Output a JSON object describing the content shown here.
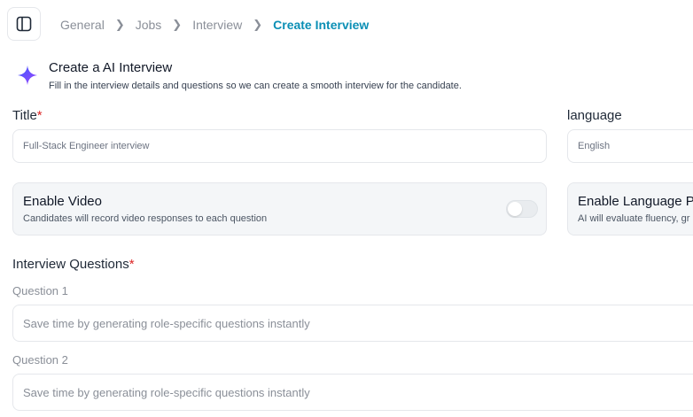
{
  "topbar": {
    "sidebar_toggle_icon": "sidebar-panel-icon",
    "breadcrumb": [
      {
        "label": "General"
      },
      {
        "label": "Jobs"
      },
      {
        "label": "Interview"
      },
      {
        "label": "Create Interview"
      }
    ],
    "separator_icon": "chevron-right-icon"
  },
  "header": {
    "icon": "sparkle-icon",
    "title": "Create a  AI Interview",
    "subtitle": "Fill in the interview details and questions so we can create a smooth interview for the candidate."
  },
  "form": {
    "title_label": "Title",
    "required_mark": "*",
    "title_value": "Full-Stack Engineer interview",
    "language_label": "language",
    "language_value": "English",
    "video_card": {
      "title": "Enable Video",
      "description": "Candidates will record video responses to each question",
      "enabled": false
    },
    "language_card": {
      "title": "Enable Language Pr",
      "description": "AI will evaluate fluency, gr"
    },
    "questions_label": "Interview Questions",
    "questions": [
      {
        "label": "Question 1",
        "placeholder": "Save time by generating role-specific questions instantly"
      },
      {
        "label": "Question 2",
        "placeholder": "Save time by generating role-specific questions instantly"
      }
    ]
  },
  "colors": {
    "accent": "#0b8fb5",
    "required": "#dc2626",
    "sparkle_start": "#3b5bfd",
    "sparkle_end": "#a044ff"
  }
}
